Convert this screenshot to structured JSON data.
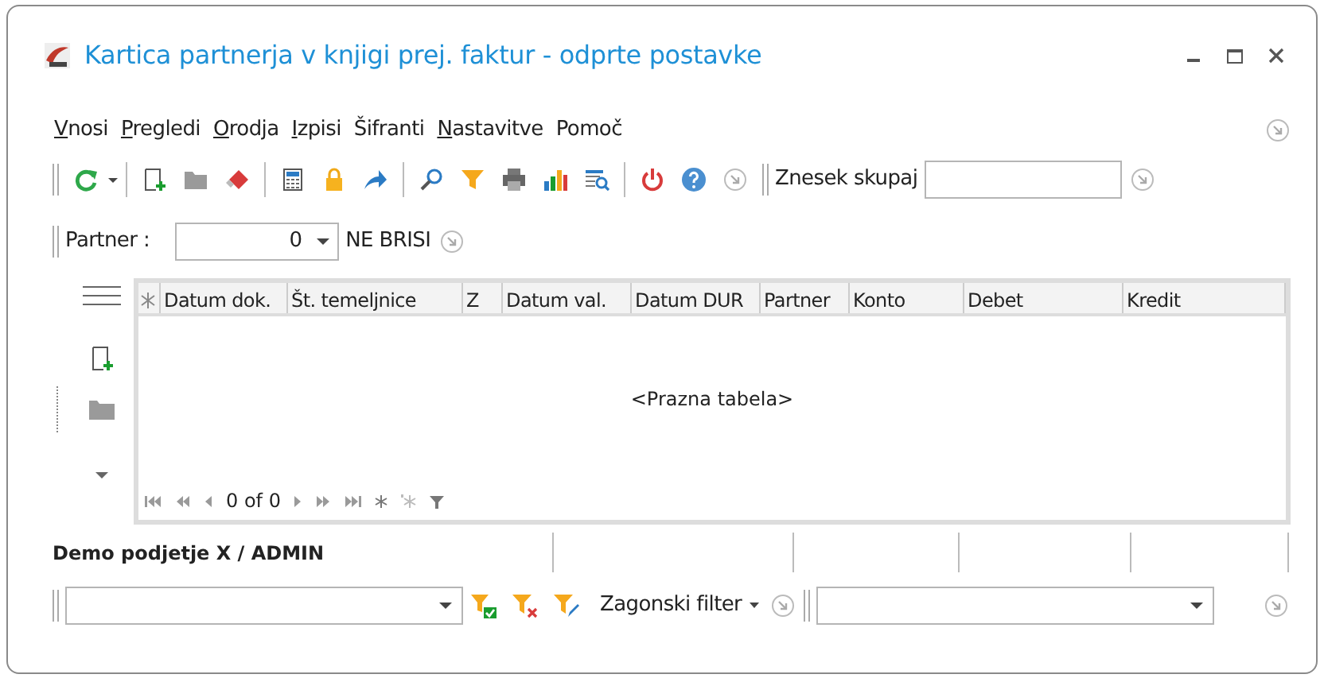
{
  "window": {
    "title": "Kartica partnerja v knjigi prej. faktur - odprte postavke"
  },
  "menu": [
    {
      "label": "Vnosi",
      "underlined_first": true
    },
    {
      "label": "Pregledi",
      "underlined_first": true
    },
    {
      "label": "Orodja",
      "underlined_first": true
    },
    {
      "label": "Izpisi",
      "underlined_first": true
    },
    {
      "label": "Šifranti",
      "underlined_first": false
    },
    {
      "label": "Nastavitve",
      "underlined_first": true
    },
    {
      "label": "Pomoč",
      "underlined_first": false
    }
  ],
  "toolbar": {
    "total_label": "Znesek skupaj"
  },
  "partner_bar": {
    "label": "Partner :",
    "value": "0",
    "option": "NE BRISI"
  },
  "grid": {
    "columns": [
      "Datum dok.",
      "Št. temeljnice",
      "Z",
      "Datum val.",
      "Datum DUR",
      "Partner",
      "Konto",
      "Debet",
      "Kredit"
    ],
    "empty_text": "<Prazna tabela>",
    "navigator": "0 of 0"
  },
  "status_bar": {
    "company": "Demo podjetje X / ADMIN"
  },
  "filter_bar": {
    "menu_label": "Zagonski filter"
  }
}
